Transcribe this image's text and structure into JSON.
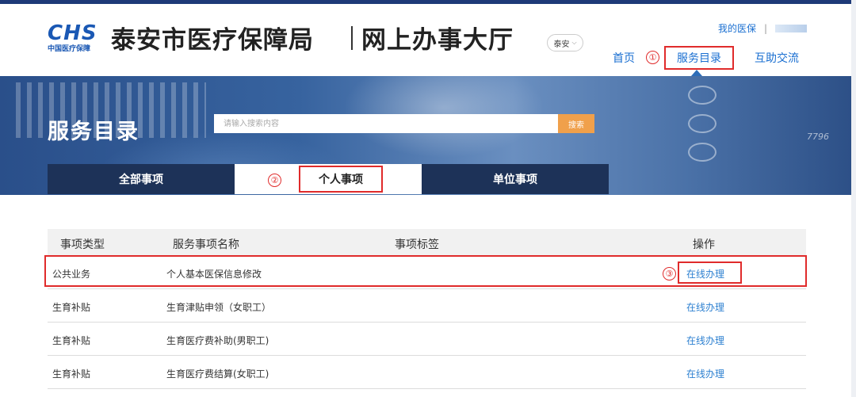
{
  "header": {
    "logo_text": "CHS",
    "logo_subtitle": "中国医疗保障",
    "site_title": "泰安市医疗保障局",
    "site_subtitle": "网上办事大厅",
    "city": "泰安",
    "my_medical": "我的医保",
    "separator": "|"
  },
  "nav": {
    "home": "首页",
    "service_catalog": "服务目录",
    "help": "互助交流"
  },
  "annotations": {
    "one": "①",
    "two": "②",
    "three": "③"
  },
  "banner": {
    "title": "服务目录",
    "search_placeholder": "请输入搜索内容",
    "search_button": "搜索",
    "deco": "7796"
  },
  "tabs": [
    {
      "label": "全部事项"
    },
    {
      "label": "个人事项"
    },
    {
      "label": "单位事项"
    }
  ],
  "table": {
    "columns": [
      "事项类型",
      "服务事项名称",
      "事项标签",
      "操作"
    ],
    "rows": [
      {
        "type": "公共业务",
        "name": "个人基本医保信息修改",
        "tag": "",
        "action": "在线办理"
      },
      {
        "type": "生育补贴",
        "name": "生育津贴申领（女职工）",
        "tag": "",
        "action": "在线办理"
      },
      {
        "type": "生育补贴",
        "name": "生育医疗费补助(男职工)",
        "tag": "",
        "action": "在线办理"
      },
      {
        "type": "生育补贴",
        "name": "生育医疗费结算(女职工)",
        "tag": "",
        "action": "在线办理"
      }
    ]
  },
  "colors": {
    "accent": "#1a6fd1",
    "annotation": "#e02b2b",
    "tab_dark": "#1d3258",
    "search_button": "#f0a04b"
  }
}
